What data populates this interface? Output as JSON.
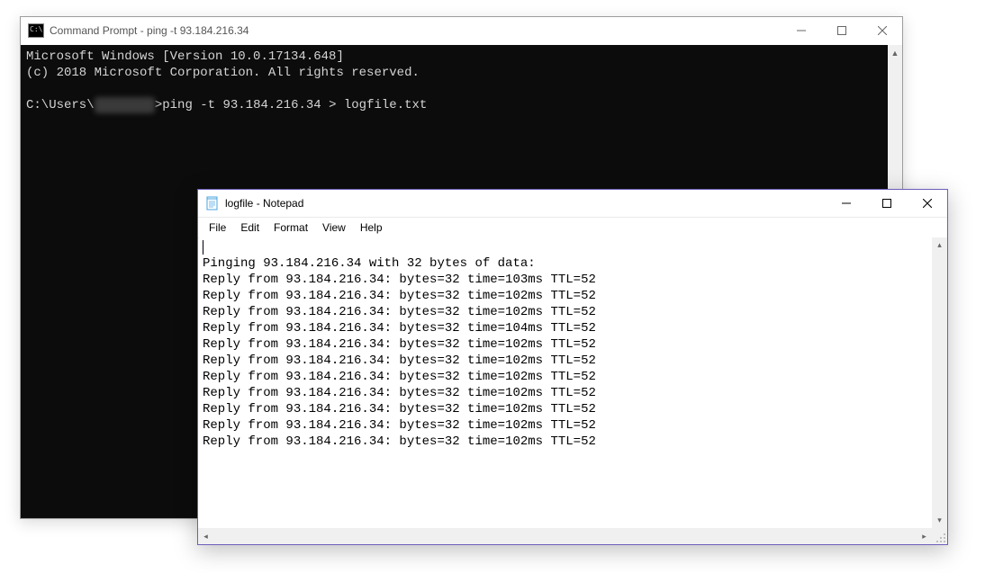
{
  "cmd": {
    "title": "Command Prompt - ping  -t 93.184.216.34",
    "line1": "Microsoft Windows [Version 10.0.17134.648]",
    "line2": "(c) 2018 Microsoft Corporation. All rights reserved.",
    "prompt_prefix": "C:\\Users\\",
    "user_masked": "xxxxxxxx",
    "prompt_suffix": ">",
    "typed_command": "ping -t 93.184.216.34 > logfile.txt"
  },
  "notepad": {
    "title": "logfile - Notepad",
    "menu": {
      "file": "File",
      "edit": "Edit",
      "format": "Format",
      "view": "View",
      "help": "Help"
    },
    "blank_first_line": "",
    "header": "Pinging 93.184.216.34 with 32 bytes of data:",
    "lines": [
      "Reply from 93.184.216.34: bytes=32 time=103ms TTL=52",
      "Reply from 93.184.216.34: bytes=32 time=102ms TTL=52",
      "Reply from 93.184.216.34: bytes=32 time=102ms TTL=52",
      "Reply from 93.184.216.34: bytes=32 time=104ms TTL=52",
      "Reply from 93.184.216.34: bytes=32 time=102ms TTL=52",
      "Reply from 93.184.216.34: bytes=32 time=102ms TTL=52",
      "Reply from 93.184.216.34: bytes=32 time=102ms TTL=52",
      "Reply from 93.184.216.34: bytes=32 time=102ms TTL=52",
      "Reply from 93.184.216.34: bytes=32 time=102ms TTL=52",
      "Reply from 93.184.216.34: bytes=32 time=102ms TTL=52",
      "Reply from 93.184.216.34: bytes=32 time=102ms TTL=52"
    ]
  }
}
